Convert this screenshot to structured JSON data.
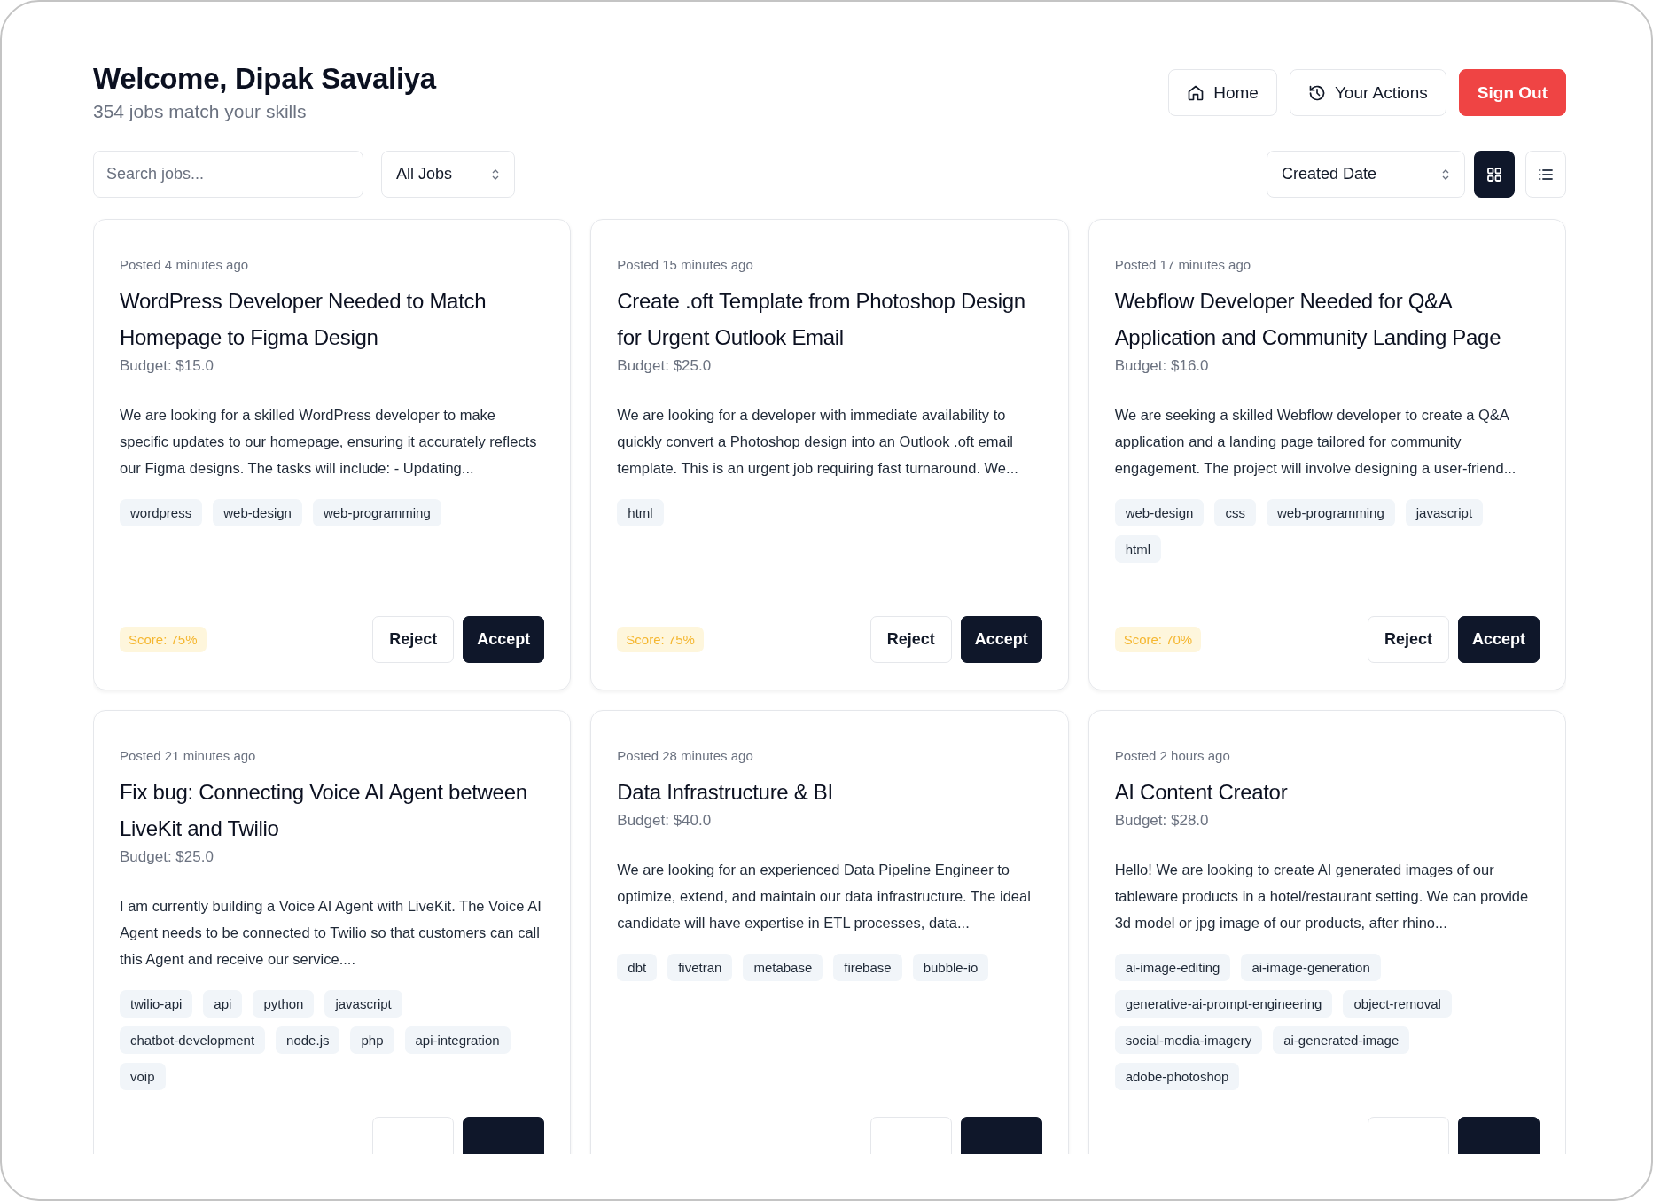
{
  "header": {
    "title": "Welcome, Dipak Savaliya",
    "subtitle": "354 jobs match your skills"
  },
  "nav": [
    {
      "kind": "home",
      "label": "Home"
    },
    {
      "kind": "history",
      "label": "Your Actions"
    },
    {
      "kind": "signout",
      "label": "Sign Out"
    }
  ],
  "filters": {
    "search": {
      "placeholder": "Search jobs..."
    },
    "job_filter": "All Jobs",
    "sort": "Created Date",
    "views": [
      {
        "kind": "grid",
        "selected": true
      },
      {
        "kind": "list",
        "selected": false
      }
    ]
  },
  "jobs": [
    {
      "posted": "Posted 4 minutes ago",
      "title": "WordPress Developer Needed to Match Homepage to Figma Design",
      "budget": "Budget: $15.0",
      "description": "We are looking for a skilled WordPress developer to make specific updates to our homepage, ensuring it accurately reflects our Figma designs. The tasks will include: - Updating...",
      "tags": [
        "wordpress",
        "web-design",
        "web-programming"
      ],
      "score": "Score: 75%",
      "actions": [
        {
          "kind": "reject",
          "label": "Reject"
        },
        {
          "kind": "accept",
          "label": "Accept"
        }
      ]
    },
    {
      "posted": "Posted 15 minutes ago",
      "title": "Create .oft Template from Photoshop Design for Urgent Outlook Email",
      "budget": "Budget: $25.0",
      "description": "We are looking for a developer with immediate availability to quickly convert a Photoshop design into an Outlook .oft email template. This is an urgent job requiring fast turnaround. We...",
      "tags": [
        "html"
      ],
      "score": "Score: 75%",
      "actions": [
        {
          "kind": "reject",
          "label": "Reject"
        },
        {
          "kind": "accept",
          "label": "Accept"
        }
      ]
    },
    {
      "posted": "Posted 17 minutes ago",
      "title": "Webflow Developer Needed for Q&A Application and Community Landing Page",
      "budget": "Budget: $16.0",
      "description": "We are seeking a skilled Webflow developer to create a Q&A application and a landing page tailored for community engagement. The project will involve designing a user-friend...",
      "tags": [
        "web-design",
        "css",
        "web-programming",
        "javascript",
        "html"
      ],
      "score": "Score: 70%",
      "actions": [
        {
          "kind": "reject",
          "label": "Reject"
        },
        {
          "kind": "accept",
          "label": "Accept"
        }
      ]
    },
    {
      "posted": "Posted 21 minutes ago",
      "title": "Fix bug: Connecting Voice AI Agent between LiveKit and Twilio",
      "budget": "Budget: $25.0",
      "description": "I am currently building a Voice AI Agent with LiveKit. The Voice AI Agent needs to be connected to Twilio so that customers can call this Agent and receive our service....",
      "tags": [
        "twilio-api",
        "api",
        "python",
        "javascript",
        "chatbot-development",
        "node.js",
        "php",
        "api-integration",
        "voip"
      ],
      "actions": [
        {
          "kind": "reject"
        },
        {
          "kind": "accept"
        }
      ]
    },
    {
      "posted": "Posted 28 minutes ago",
      "title": "Data Infrastructure & BI",
      "budget": "Budget: $40.0",
      "description": "We are looking for an experienced Data Pipeline Engineer to optimize, extend, and maintain our data infrastructure. The ideal candidate will have expertise in ETL processes, data...",
      "tags": [
        "dbt",
        "fivetran",
        "metabase",
        "firebase",
        "bubble-io"
      ],
      "actions": [
        {
          "kind": "reject"
        },
        {
          "kind": "accept"
        }
      ]
    },
    {
      "posted": "Posted 2 hours ago",
      "title": "AI Content Creator",
      "budget": "Budget: $28.0",
      "description": "Hello! We are looking to create AI generated images of our tableware products in a hotel/restaurant setting. We can provide 3d model or jpg image of our products, after rhino...",
      "tags": [
        "ai-image-editing",
        "ai-image-generation",
        "generative-ai-prompt-engineering",
        "object-removal",
        "social-media-imagery",
        "ai-generated-image",
        "adobe-photoshop"
      ],
      "actions": [
        {
          "kind": "reject"
        },
        {
          "kind": "accept"
        }
      ]
    }
  ]
}
